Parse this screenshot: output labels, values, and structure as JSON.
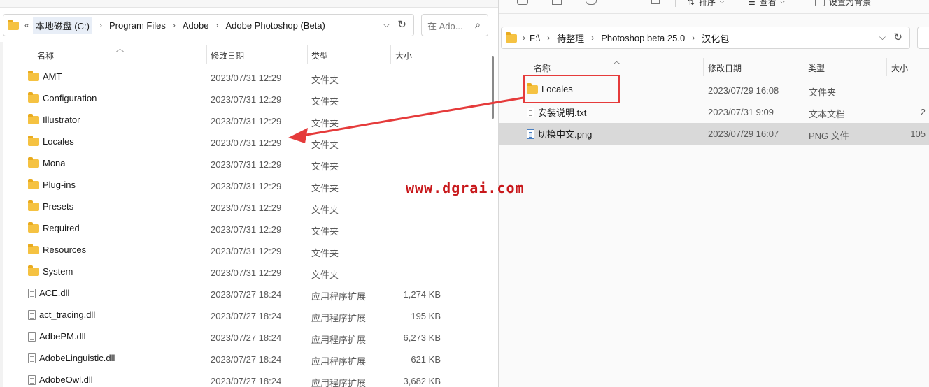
{
  "left": {
    "breadcrumb": [
      "本地磁盘 (C:)",
      "Program Files",
      "Adobe",
      "Adobe Photoshop (Beta)"
    ],
    "overflow_glyph": "«",
    "search_placeholder": "在 Ado...",
    "columns": {
      "name": "名称",
      "date": "修改日期",
      "type": "类型",
      "size": "大小"
    },
    "rows": [
      {
        "name": "AMT",
        "date": "2023/07/31 12:29",
        "type": "文件夹",
        "size": "",
        "icon": "folder-icon"
      },
      {
        "name": "Configuration",
        "date": "2023/07/31 12:29",
        "type": "文件夹",
        "size": "",
        "icon": "folder-icon"
      },
      {
        "name": "Illustrator",
        "date": "2023/07/31 12:29",
        "type": "文件夹",
        "size": "",
        "icon": "folder-icon"
      },
      {
        "name": "Locales",
        "date": "2023/07/31 12:29",
        "type": "文件夹",
        "size": "",
        "icon": "folder-icon"
      },
      {
        "name": "Mona",
        "date": "2023/07/31 12:29",
        "type": "文件夹",
        "size": "",
        "icon": "folder-icon"
      },
      {
        "name": "Plug-ins",
        "date": "2023/07/31 12:29",
        "type": "文件夹",
        "size": "",
        "icon": "folder-icon"
      },
      {
        "name": "Presets",
        "date": "2023/07/31 12:29",
        "type": "文件夹",
        "size": "",
        "icon": "folder-icon"
      },
      {
        "name": "Required",
        "date": "2023/07/31 12:29",
        "type": "文件夹",
        "size": "",
        "icon": "folder-icon"
      },
      {
        "name": "Resources",
        "date": "2023/07/31 12:29",
        "type": "文件夹",
        "size": "",
        "icon": "folder-icon"
      },
      {
        "name": "System",
        "date": "2023/07/31 12:29",
        "type": "文件夹",
        "size": "",
        "icon": "folder-icon"
      },
      {
        "name": "ACE.dll",
        "date": "2023/07/27 18:24",
        "type": "应用程序扩展",
        "size": "1,274 KB",
        "icon": "dll-file-icon"
      },
      {
        "name": "act_tracing.dll",
        "date": "2023/07/27 18:24",
        "type": "应用程序扩展",
        "size": "195 KB",
        "icon": "dll-file-icon"
      },
      {
        "name": "AdbePM.dll",
        "date": "2023/07/27 18:24",
        "type": "应用程序扩展",
        "size": "6,273 KB",
        "icon": "dll-file-icon"
      },
      {
        "name": "AdobeLinguistic.dll",
        "date": "2023/07/27 18:24",
        "type": "应用程序扩展",
        "size": "621 KB",
        "icon": "dll-file-icon"
      },
      {
        "name": "AdobeOwl.dll",
        "date": "2023/07/27 18:24",
        "type": "应用程序扩展",
        "size": "3,682 KB",
        "icon": "dll-file-icon"
      }
    ]
  },
  "right": {
    "toolbar": {
      "sort_label": "排序",
      "view_label": "查看",
      "setbg_label": "设置为背景"
    },
    "breadcrumb": [
      "F:\\",
      "待整理",
      "Photoshop beta 25.0",
      "汉化包"
    ],
    "columns": {
      "name": "名称",
      "date": "修改日期",
      "type": "类型",
      "size": "大小"
    },
    "rows": [
      {
        "name": "Locales",
        "date": "2023/07/29 16:08",
        "type": "文件夹",
        "size": "",
        "icon": "folder-icon"
      },
      {
        "name": "安装说明.txt",
        "date": "2023/07/31 9:09",
        "type": "文本文档",
        "size": "2",
        "icon": "txt-file-icon"
      },
      {
        "name": "切换中文.png",
        "date": "2023/07/29 16:07",
        "type": "PNG 文件",
        "size": "105",
        "icon": "png-file-icon",
        "selected": true
      }
    ]
  },
  "watermark": "www.dgrai.com",
  "colors": {
    "highlight_red": "#e53b3b",
    "watermark_red": "#c8181b",
    "folder": "#f5c242",
    "selected_row": "#d9d9d9"
  }
}
